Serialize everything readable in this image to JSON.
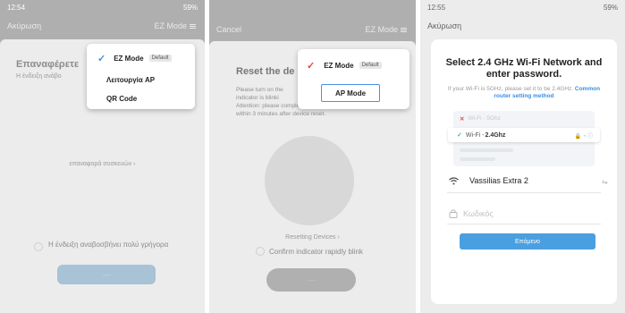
{
  "panel1": {
    "status_time": "12:54",
    "status_right": "59%",
    "cancel_label": "Ακύρωση",
    "mode_label": "EZ Mode",
    "heading": "Επαναφέρετε",
    "subtext": "Η ένδειξη ανάβο",
    "reset_link": "επαναφορά συσκευών",
    "confirm_text": "Η ένδειξη αναβοσβήνει πολύ γρήγορα",
    "menu": {
      "items": [
        {
          "label": "EZ Mode",
          "tag": "Default"
        },
        {
          "label": "Λειτουργία AP"
        },
        {
          "label": "QR Code"
        }
      ]
    }
  },
  "panel2": {
    "cancel_label": "Cancel",
    "mode_label": "EZ Mode",
    "heading": "Reset the de",
    "body_lines": [
      "Please turn on the",
      "indicator is blinki",
      "Attention: please complete pairing process",
      "within 3 minutes after device reset."
    ],
    "reset_link": "Resetting Devices",
    "confirm_text": "Confirm indicator rapidly blink",
    "menu": {
      "items": [
        {
          "label": "EZ Mode",
          "tag": "Default"
        },
        {
          "label": "AP Mode"
        }
      ]
    }
  },
  "panel3": {
    "status_time": "12:55",
    "status_right": "59%",
    "cancel_label": "Ακύρωση",
    "title": "Select 2.4 GHz Wi-Fi Network and enter password.",
    "hint": "If your Wi-Fi is 5GHz, please set it to be 2.4GHz.",
    "hint_link": "Common router setting method",
    "wifi_bad": "Wi-Fi - 5Ghz",
    "wifi_good_prefix": "Wi-Fi - ",
    "wifi_good_band": "2.4Ghz",
    "network_name": "Vassilias Extra 2",
    "password_placeholder": "Κωδικός",
    "next_label": "Επόμενο",
    "colors": {
      "accent": "#4a9fe0",
      "link": "#3a8ee6",
      "good": "#2ecc71",
      "bad": "#e74c3c"
    }
  }
}
